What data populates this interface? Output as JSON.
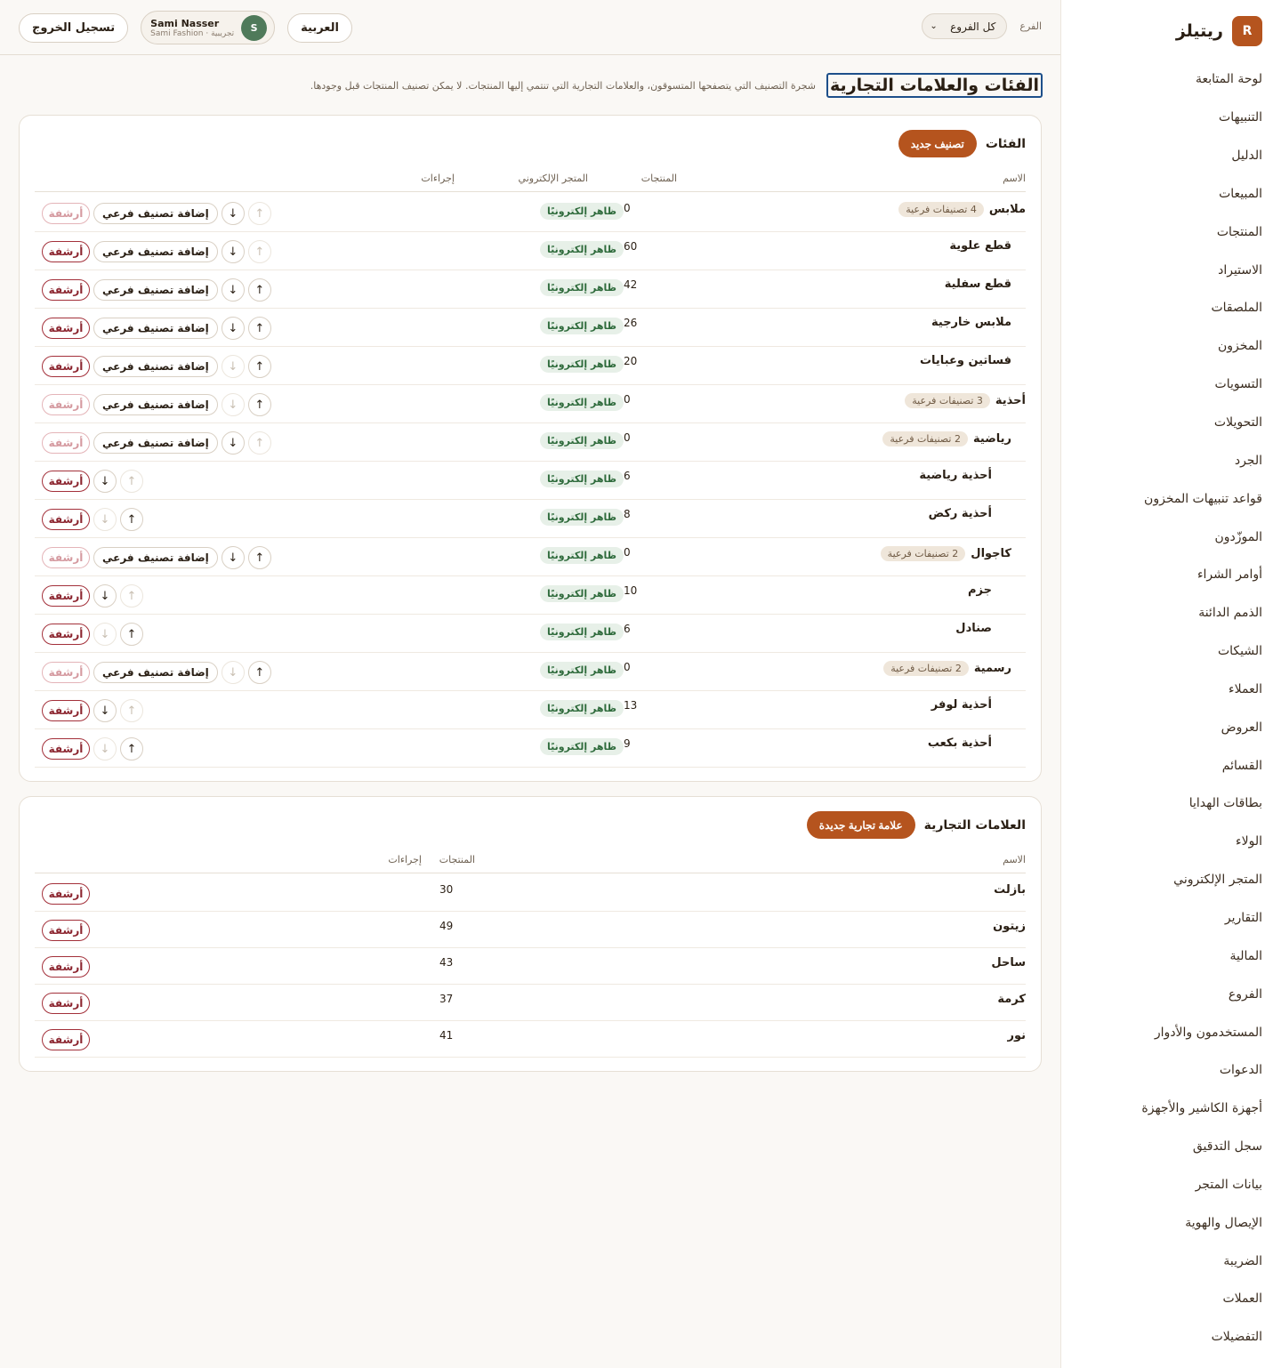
{
  "brand": {
    "logo_letter": "R",
    "name": "ريتيلز"
  },
  "nav": [
    "لوحة المتابعة",
    "التنبيهات",
    "الدليل",
    "المبيعات",
    "المنتجات",
    "الاستيراد",
    "الملصقات",
    "المخزون",
    "التسويات",
    "التحويلات",
    "الجرد",
    "قواعد تنبيهات المخزون",
    "الموزّدون",
    "أوامر الشراء",
    "الذمم الدائنة",
    "الشيكات",
    "العملاء",
    "العروض",
    "القسائم",
    "بطاقات الهدايا",
    "الولاء",
    "المتجر الإلكتروني",
    "التقارير",
    "المالية",
    "الفروع",
    "المستخدمون والأدوار",
    "الدعوات",
    "أجهزة الكاشير والأجهزة",
    "سجل التدقيق",
    "بيانات المتجر",
    "الإيصال والهوية",
    "الضريبة",
    "العملات",
    "التفضيلات"
  ],
  "topbar": {
    "branch_label": "الفرع",
    "branch_value": "كل الفروع",
    "language_button": "العربية",
    "user_name": "Sami Nasser",
    "user_sub": "Sami Fashion · تجريبية",
    "avatar_letter": "S",
    "logout_button": "تسجيل الخروج"
  },
  "page": {
    "title": "الفئات والعلامات التجارية",
    "description": "شجرة التصنيف التي يتصفحها المتسوقون، والعلامات التجارية التي تنتمي إليها المنتجات. لا يمكن تصنيف المنتجات قبل وجودها."
  },
  "categories": {
    "title": "الفئات",
    "new_button": "تصنيف جديد",
    "headers": {
      "name": "الاسم",
      "products": "المنتجات",
      "store": "المتجر الإلكتروني",
      "actions": "إجراءات"
    },
    "store_badge": "ظاهر إلكترونيًا",
    "add_sub_label": "إضافة تصنيف فرعي",
    "archive_label": "أرشفة",
    "up_arrow": "↑",
    "down_arrow": "↓",
    "rows": [
      {
        "name": "ملابس",
        "badge": "4 تصنيفات فرعية",
        "products": "0",
        "level": 0,
        "addsub": true,
        "up_enabled": false,
        "down_enabled": true,
        "archive_enabled": false
      },
      {
        "name": "قطع علوية",
        "badge": "",
        "products": "60",
        "level": 1,
        "addsub": true,
        "up_enabled": false,
        "down_enabled": true,
        "archive_enabled": true
      },
      {
        "name": "قطع سفلية",
        "badge": "",
        "products": "42",
        "level": 1,
        "addsub": true,
        "up_enabled": true,
        "down_enabled": true,
        "archive_enabled": true
      },
      {
        "name": "ملابس خارجية",
        "badge": "",
        "products": "26",
        "level": 1,
        "addsub": true,
        "up_enabled": true,
        "down_enabled": true,
        "archive_enabled": true
      },
      {
        "name": "فساتين وعبايات",
        "badge": "",
        "products": "20",
        "level": 1,
        "addsub": true,
        "up_enabled": true,
        "down_enabled": false,
        "archive_enabled": true
      },
      {
        "name": "أحذية",
        "badge": "3 تصنيفات فرعية",
        "products": "0",
        "level": 0,
        "addsub": true,
        "up_enabled": true,
        "down_enabled": false,
        "archive_enabled": false
      },
      {
        "name": "رياضية",
        "badge": "2 تصنيفات فرعية",
        "products": "0",
        "level": 1,
        "addsub": true,
        "up_enabled": false,
        "down_enabled": true,
        "archive_enabled": false
      },
      {
        "name": "أحذية رياضية",
        "badge": "",
        "products": "6",
        "level": 2,
        "addsub": false,
        "up_enabled": false,
        "down_enabled": true,
        "archive_enabled": true
      },
      {
        "name": "أحذية ركض",
        "badge": "",
        "products": "8",
        "level": 2,
        "addsub": false,
        "up_enabled": true,
        "down_enabled": false,
        "archive_enabled": true
      },
      {
        "name": "كاجوال",
        "badge": "2 تصنيفات فرعية",
        "products": "0",
        "level": 1,
        "addsub": true,
        "up_enabled": true,
        "down_enabled": true,
        "archive_enabled": false
      },
      {
        "name": "جزم",
        "badge": "",
        "products": "10",
        "level": 2,
        "addsub": false,
        "up_enabled": false,
        "down_enabled": true,
        "archive_enabled": true
      },
      {
        "name": "صنادل",
        "badge": "",
        "products": "6",
        "level": 2,
        "addsub": false,
        "up_enabled": true,
        "down_enabled": false,
        "archive_enabled": true
      },
      {
        "name": "رسمية",
        "badge": "2 تصنيفات فرعية",
        "products": "0",
        "level": 1,
        "addsub": true,
        "up_enabled": true,
        "down_enabled": false,
        "archive_enabled": false
      },
      {
        "name": "أحذية لوفر",
        "badge": "",
        "products": "13",
        "level": 2,
        "addsub": false,
        "up_enabled": false,
        "down_enabled": true,
        "archive_enabled": true
      },
      {
        "name": "أحذية بكعب",
        "badge": "",
        "products": "9",
        "level": 2,
        "addsub": false,
        "up_enabled": true,
        "down_enabled": false,
        "archive_enabled": true
      }
    ]
  },
  "brands": {
    "title": "العلامات التجارية",
    "new_button": "علامة تجارية جديدة",
    "headers": {
      "name": "الاسم",
      "products": "المنتجات",
      "actions": "إجراءات"
    },
    "archive_label": "أرشفة",
    "rows": [
      {
        "name": "بازلت",
        "products": "30"
      },
      {
        "name": "زيتون",
        "products": "49"
      },
      {
        "name": "ساحل",
        "products": "43"
      },
      {
        "name": "كرمة",
        "products": "37"
      },
      {
        "name": "نور",
        "products": "41"
      }
    ]
  },
  "colors": {
    "accent": "#b5541e",
    "danger": "#a3303a",
    "success": "#2f6b3c",
    "focus": "#1d4f8a"
  }
}
